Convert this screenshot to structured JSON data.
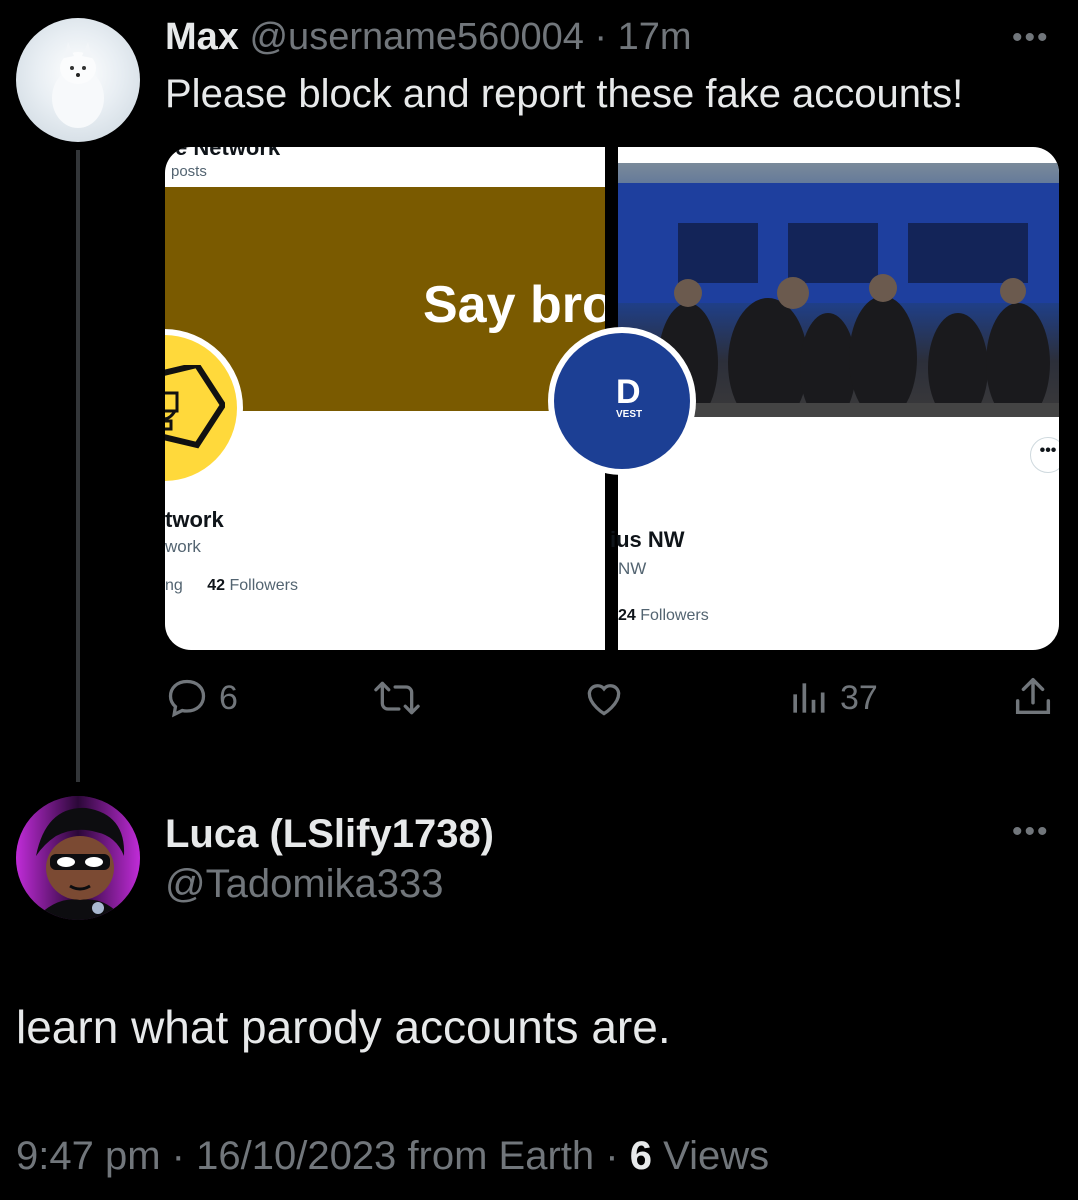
{
  "tweet": {
    "display_name": "Max",
    "handle": "@username560004",
    "separator": "·",
    "time": "17m",
    "more_icon": "more-horizontal-icon",
    "text": "Please block and report these fake accounts!",
    "left_card": {
      "top_title": "e Network",
      "posts": "posts",
      "banner_text": "Say bro",
      "banner_color": "#7a5a00",
      "avatar_color": "#ffd93b",
      "name": "twork",
      "handle": "work",
      "following_fragment": "ng",
      "followers_count": "42",
      "followers_label": "Followers"
    },
    "right_card": {
      "avatar_text": "D",
      "avatar_subtext": "VEST",
      "avatar_color": "#1c3f94",
      "name": "ius NW",
      "handle": "NW",
      "followers_count": "24",
      "followers_label": "Followers"
    },
    "actions": {
      "replies": "6",
      "views": "37"
    }
  },
  "reply": {
    "display_name": "Luca (LSlify1738)",
    "handle": "@Tadomika333",
    "text": "learn what parody accounts are.",
    "time": "9:47 pm",
    "sep1": "·",
    "date": "16/10/2023",
    "source": "from Earth",
    "sep2": "·",
    "views_count": "6",
    "views_label": "Views"
  },
  "colors": {
    "background": "#000000",
    "text": "#e7e9ea",
    "secondary": "#71767b",
    "thread_line": "#333639"
  }
}
